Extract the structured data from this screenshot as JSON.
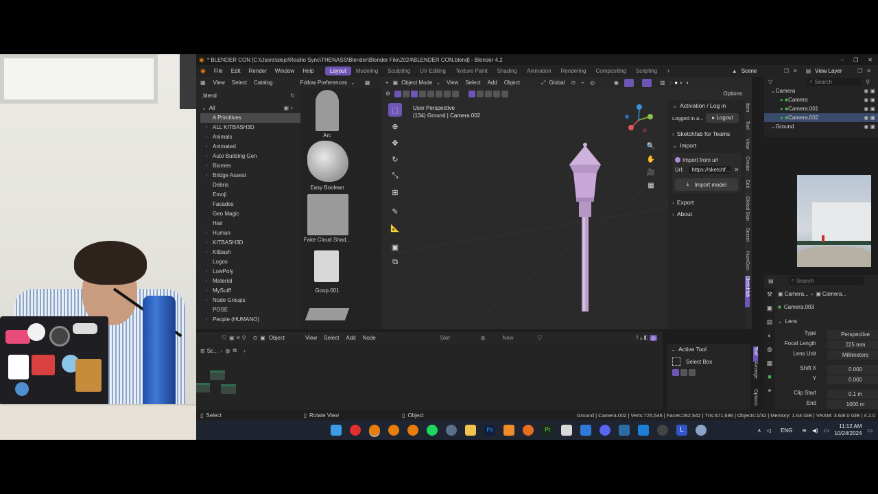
{
  "window": {
    "title": "* BLENDER CON [C:\\Users\\alejo\\Resilio Sync\\THENASS\\Blender\\Blender File\\2024\\BLENDER CON.blend] - Blender 4.2"
  },
  "menu": [
    "File",
    "Edit",
    "Render",
    "Window",
    "Help"
  ],
  "workspaces": [
    "Layout",
    "Modeling",
    "Sculpting",
    "UV Editing",
    "Texture Paint",
    "Shading",
    "Animation",
    "Rendering",
    "Compositing",
    "Scripting"
  ],
  "scene": {
    "scene_label": "Scene",
    "view_layer_label": "View Layer"
  },
  "asset_browser": {
    "header": [
      "View",
      "Select",
      "Catalog"
    ],
    "follow_prefs": "Follow Preferences",
    "library": ".blend",
    "all_label": "All",
    "categories": [
      {
        "label": "A Primitives",
        "expand": false,
        "selected": true
      },
      {
        "label": "ALL KITBASH3D",
        "expand": true
      },
      {
        "label": "Animals",
        "expand": true
      },
      {
        "label": "Animated",
        "expand": true
      },
      {
        "label": "Auto Building Gen",
        "expand": true
      },
      {
        "label": "Biomes",
        "expand": true
      },
      {
        "label": "Bridge Assest",
        "expand": true
      },
      {
        "label": "Debris",
        "expand": false
      },
      {
        "label": "Emoji",
        "expand": false
      },
      {
        "label": "Facades",
        "expand": false
      },
      {
        "label": "Geo Magic",
        "expand": false
      },
      {
        "label": "Hair",
        "expand": false
      },
      {
        "label": "Human",
        "expand": true
      },
      {
        "label": "KITBASH3D",
        "expand": true
      },
      {
        "label": "Kitbash",
        "expand": true
      },
      {
        "label": "Logos",
        "expand": false
      },
      {
        "label": "LowPoly",
        "expand": true
      },
      {
        "label": "Material",
        "expand": true
      },
      {
        "label": "MySutff",
        "expand": true
      },
      {
        "label": "Node Groups",
        "expand": true
      },
      {
        "label": "POSE",
        "expand": false
      },
      {
        "label": "People (HUMANO)",
        "expand": true
      }
    ],
    "assets": [
      "Arc",
      "Easy Boolean",
      "Fake Cloud Shad...",
      "Goop.001"
    ]
  },
  "viewport": {
    "header": {
      "mode": "Object Mode",
      "items": [
        "View",
        "Select",
        "Add",
        "Object"
      ],
      "orientation": "Global",
      "options": "Options"
    },
    "overlay_line1": "User Perspective",
    "overlay_line2": "(134) Ground | Camera.002"
  },
  "npanel": {
    "activation": "Activation / Log in",
    "logged_in": "Logged in a...",
    "logout": "Logout",
    "sketchfab_teams": "Sketchfab for Teams",
    "import": "Import",
    "import_from_url": "Import from url",
    "url_label": "Url:",
    "url_value": "https://sketchf...",
    "import_model": "Import model",
    "export": "Export",
    "about": "About",
    "vtabs": [
      "Item",
      "Tool",
      "View",
      "Create",
      "Edit",
      "Global Skin",
      "Secret",
      "HumGen",
      "Sketchfab"
    ]
  },
  "outliner": {
    "search_placeholder": "Search",
    "rows": [
      {
        "label": "Camera",
        "indent": 0
      },
      {
        "label": "Camera",
        "indent": 1
      },
      {
        "label": "Camera.001",
        "indent": 1
      },
      {
        "label": "Camera.002",
        "indent": 1,
        "selected": true
      },
      {
        "label": "Ground",
        "indent": 0
      }
    ]
  },
  "properties": {
    "search_placeholder": "Search",
    "breadcrumb_1": "Camera...",
    "breadcrumb_2": "Camera...",
    "data_name": "Camera.003",
    "section": "Lens",
    "rows": [
      {
        "label": "Type",
        "value": "Perspective"
      },
      {
        "label": "Focal Length",
        "value": "225 mm"
      },
      {
        "label": "Lens Unit",
        "value": "Millimeters"
      },
      {
        "label": "Shift X",
        "value": "0.000"
      },
      {
        "label": "Y",
        "value": "0.000"
      },
      {
        "label": "Clip Start",
        "value": "0.1 m"
      },
      {
        "label": "End",
        "value": "1000 m"
      }
    ]
  },
  "node_editor": {
    "header": [
      "Object",
      "View",
      "Select",
      "Add",
      "Node"
    ],
    "slot": "Slot",
    "new_label": "New",
    "breadcrumb": "Sc..."
  },
  "tool_panel": {
    "active_tool": "Active Tool",
    "select_box": "Select Box",
    "vtabs": [
      "Tool",
      "Arrange",
      "Options"
    ]
  },
  "statusbar": {
    "select": "Select",
    "rotate": "Rotate View",
    "object": "Object",
    "stats": "Ground | Camera.002 | Verts:725,546 | Faces:262,542 | Tris:471,696 | Objects:1/32 | Memory: 1.64 GiB | VRAM: 3.6/8.0 GiB | 4.2.0"
  },
  "taskbar": {
    "lang": "ENG",
    "time": "11:12 AM",
    "date": "10/24/2024"
  },
  "colors": {
    "accent": "#6f55b6",
    "lamp": "#c9a8d9",
    "taskbar": "#1f2530"
  }
}
